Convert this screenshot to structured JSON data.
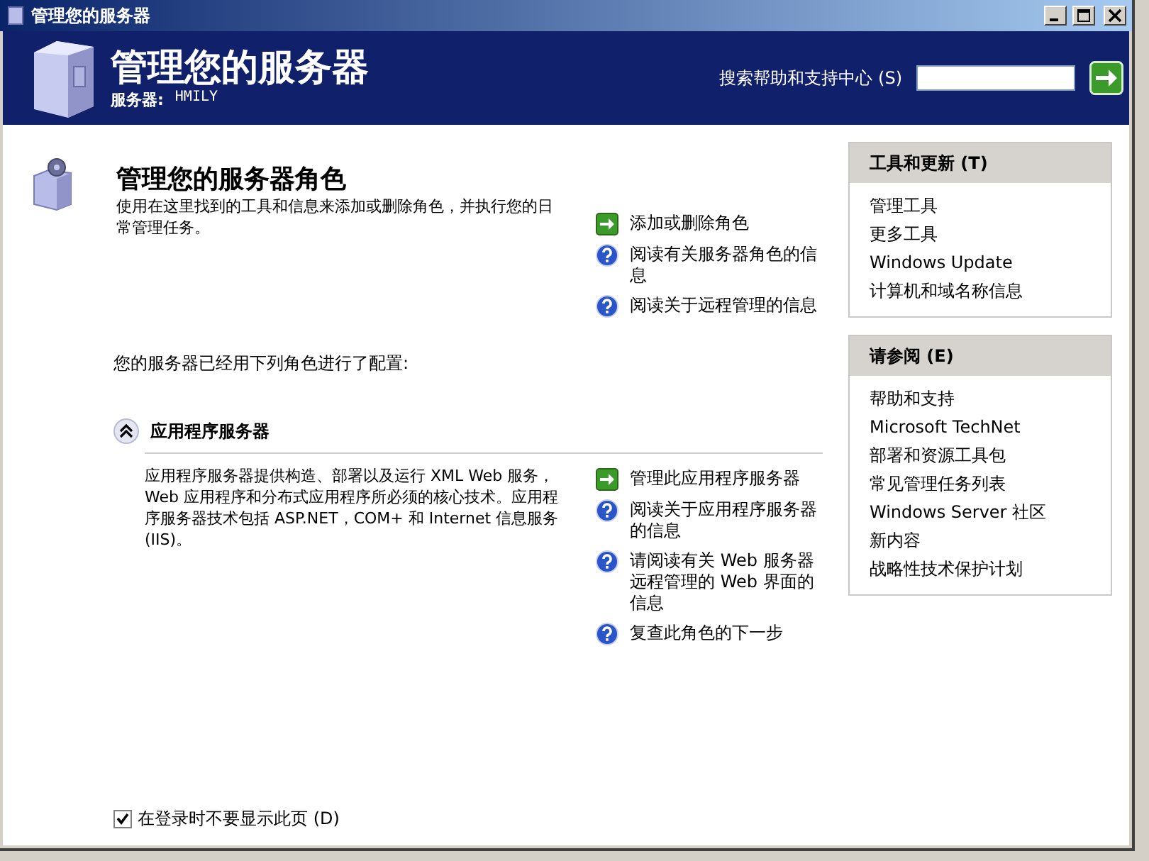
{
  "window": {
    "title": "管理您的服务器"
  },
  "header": {
    "title": "管理您的服务器",
    "server_label": "服务器:",
    "server_name": "HMILY",
    "search_label": "搜索帮助和支持中心 (S)"
  },
  "intro": {
    "title": "管理您的服务器角色",
    "description": "使用在这里找到的工具和信息来添加或删除角色，并执行您的日常管理任务。",
    "links": [
      {
        "kind": "add",
        "label": "添加或删除角色"
      },
      {
        "kind": "help",
        "label": "阅读有关服务器角色的信息"
      },
      {
        "kind": "help",
        "label": "阅读关于远程管理的信息"
      }
    ],
    "configured_note": "您的服务器已经用下列角色进行了配置:"
  },
  "roles": [
    {
      "title": "应用程序服务器",
      "expanded": true,
      "description": "应用程序服务器提供构造、部署以及运行 XML Web 服务，Web 应用程序和分布式应用程序所必须的核心技术。应用程序服务器技术包括 ASP.NET，COM+ 和 Internet 信息服务(IIS)。",
      "links": [
        {
          "kind": "add",
          "label": "管理此应用程序服务器"
        },
        {
          "kind": "help",
          "label": "阅读关于应用程序服务器的信息"
        },
        {
          "kind": "help",
          "label": "请阅读有关 Web 服务器远程管理的 Web 界面的信息"
        },
        {
          "kind": "help",
          "label": "复查此角色的下一步"
        }
      ]
    }
  ],
  "sidebar": [
    {
      "title": "工具和更新 (T)",
      "items": [
        "管理工具",
        "更多工具",
        "Windows Update",
        "计算机和域名称信息"
      ]
    },
    {
      "title": "请参阅 (E)",
      "items": [
        "帮助和支持",
        "Microsoft TechNet",
        "部署和资源工具包",
        "常见管理任务列表",
        "Windows Server 社区",
        "新内容",
        "战略性技术保护计划"
      ]
    }
  ],
  "footer": {
    "checkbox": {
      "label": "在登录时不要显示此页 (D)",
      "checked": true
    }
  }
}
